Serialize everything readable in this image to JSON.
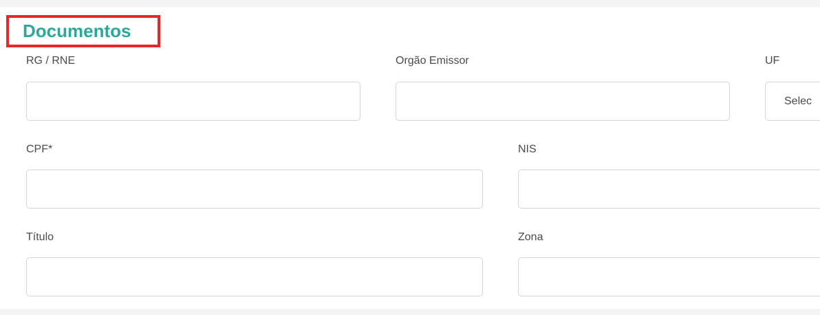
{
  "section": {
    "title": "Documentos"
  },
  "fields": {
    "rg": {
      "label": "RG / RNE",
      "value": ""
    },
    "orgao": {
      "label": "Orgão Emissor",
      "value": ""
    },
    "uf": {
      "label": "UF",
      "selected": "Selec"
    },
    "cpf": {
      "label": "CPF*",
      "value": ""
    },
    "nis": {
      "label": "NIS",
      "value": ""
    },
    "titulo": {
      "label": "Título",
      "value": ""
    },
    "zona": {
      "label": "Zona",
      "value": ""
    }
  },
  "colors": {
    "title": "#2aa89a",
    "highlight_border": "#e8262a",
    "input_border": "#d5d5d5",
    "label": "#4a4a4a",
    "background": "#f4f4f4"
  }
}
